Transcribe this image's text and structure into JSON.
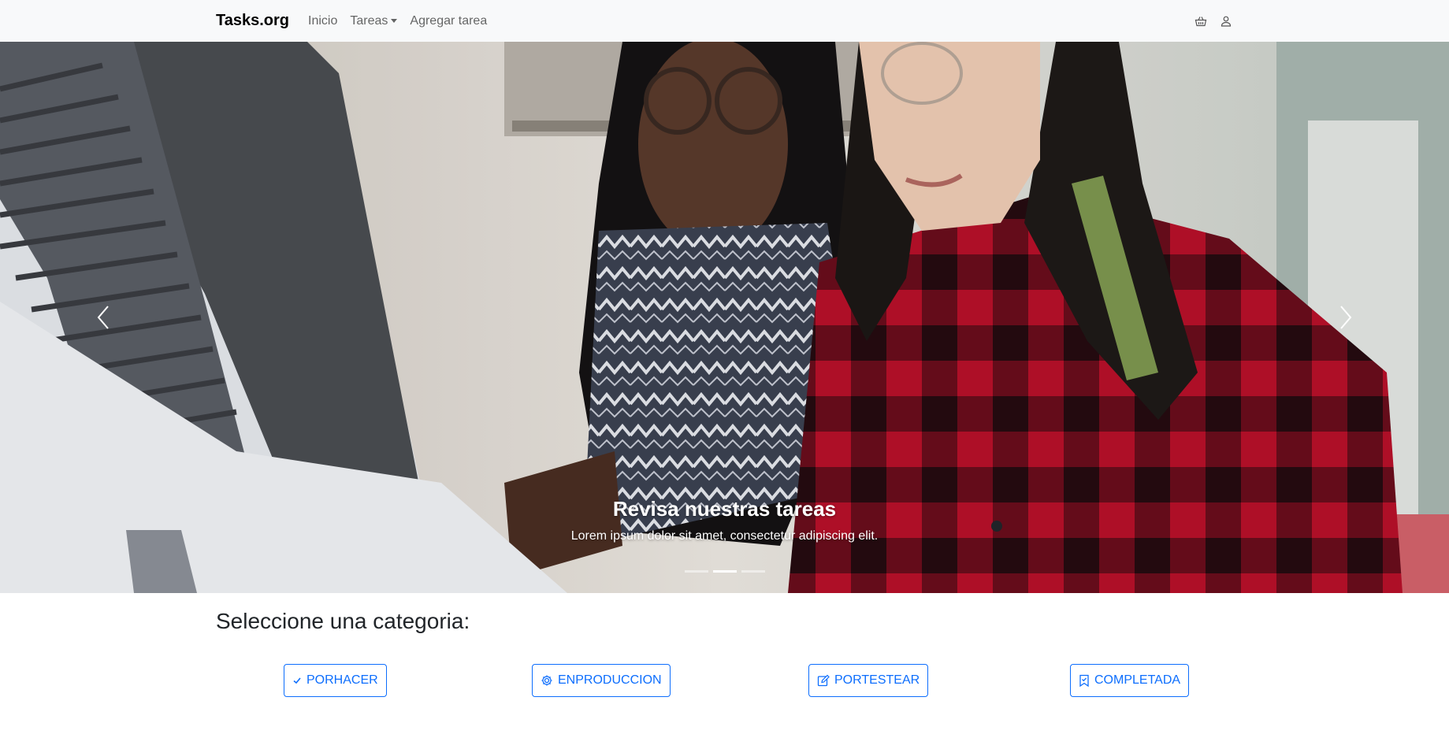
{
  "navbar": {
    "brand": "Tasks.org",
    "links": {
      "home": "Inicio",
      "tasks": "Tareas",
      "add_task": "Agregar tarea"
    },
    "icons": [
      "basket-icon",
      "person-icon"
    ]
  },
  "carousel": {
    "title": "Revisa nuestras tareas",
    "text": "Lorem ipsum dolor sit amet, consectetur adipiscing elit.",
    "slide_count": 3,
    "active_slide": 2
  },
  "categories": {
    "heading": "Seleccione una categoria:",
    "buttons": {
      "todo": "PORHACER",
      "in_progress": "ENPRODUCCION",
      "testing": "PORTESTEAR",
      "done": "COMPLETADA"
    }
  },
  "colors": {
    "primary": "#0d6efd",
    "navbar_bg": "#f8f9fa"
  }
}
